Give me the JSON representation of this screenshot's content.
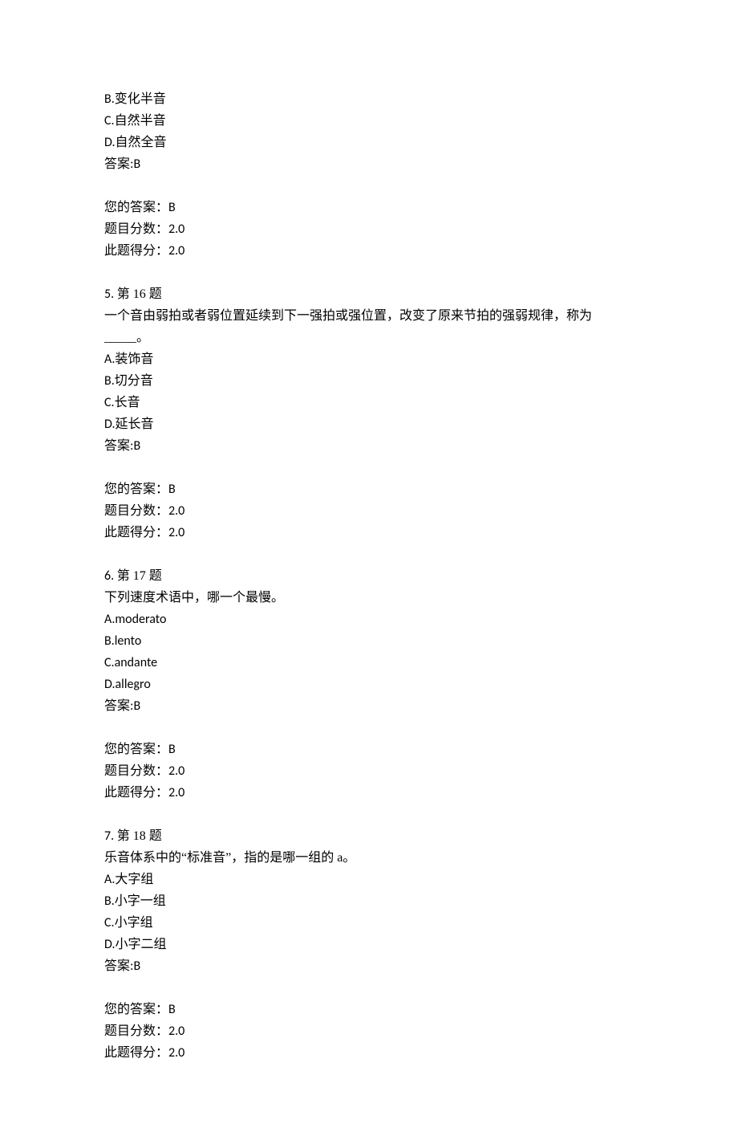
{
  "items": [
    {
      "number": "5",
      "title": "第 16 题",
      "pre_options": [
        "B.变化半音",
        "C.自然半音",
        "D.自然全音"
      ],
      "question": "一个音由弱拍或者弱位置延续到下一强拍或强位置，改变了原来节拍的强弱规律，称为_____。",
      "options": [
        "A.装饰音",
        "B.切分音",
        "C.长音",
        "D.延长音"
      ],
      "answer": "B",
      "your_answer": "B",
      "score_full": "2.0",
      "score_got": "2.0"
    },
    {
      "number": "6",
      "title": "第 17 题",
      "question": "下列速度术语中，哪一个最慢。",
      "options": [
        "A.moderato",
        "B.lento",
        "C.andante",
        "D.allegro"
      ],
      "answer": "B",
      "your_answer": "B",
      "score_full": "2.0",
      "score_got": "2.0"
    },
    {
      "number": "7",
      "title": "第 18 题",
      "question": "乐音体系中的“标准音”，指的是哪一组的 a。",
      "options": [
        "A.大字组",
        "B.小字一组",
        "C.小字组",
        "D.小字二组"
      ],
      "answer": "B",
      "your_answer": "B",
      "score_full": "2.0",
      "score_got": "2.0"
    }
  ],
  "labels": {
    "answer_prefix": "答案:",
    "your_answer_prefix": "您的答案：",
    "score_full_prefix": "题目分数：",
    "score_got_prefix": "此题得分："
  }
}
